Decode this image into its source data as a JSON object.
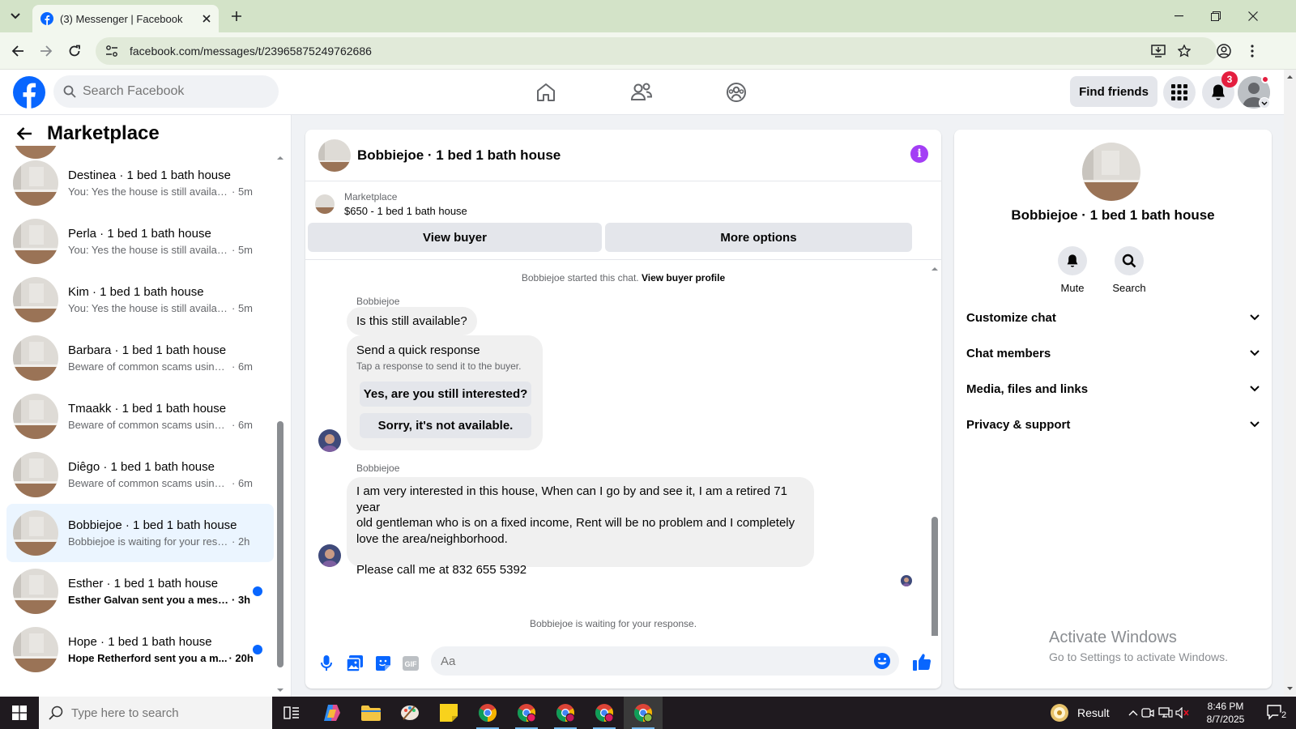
{
  "browser": {
    "tab_title": "(3) Messenger | Facebook",
    "url": "facebook.com/messages/t/23965875249762686"
  },
  "fb": {
    "search_placeholder": "Search Facebook",
    "find_friends": "Find friends",
    "notification_count": "3"
  },
  "left": {
    "title": "Marketplace",
    "conversations": [
      {
        "name": "Destinea · 1 bed 1 bath house",
        "preview": "You: Yes the house is still available ...",
        "time": "· 5m",
        "unread": false,
        "active": false
      },
      {
        "name": "Perla · 1 bed 1 bath house",
        "preview": "You: Yes the house is still available ...",
        "time": "· 5m",
        "unread": false,
        "active": false
      },
      {
        "name": "Kim · 1 bed 1 bath house",
        "preview": "You: Yes the house is still available ...",
        "time": "· 5m",
        "unread": false,
        "active": false
      },
      {
        "name": "Barbara · 1 bed 1 bath house",
        "preview": "Beware of common scams using p...",
        "time": "· 6m",
        "unread": false,
        "active": false
      },
      {
        "name": "Tmaakk · 1 bed 1 bath house",
        "preview": "Beware of common scams using p...",
        "time": "· 6m",
        "unread": false,
        "active": false
      },
      {
        "name": "Diêgo · 1 bed 1 bath house",
        "preview": "Beware of common scams using p...",
        "time": "· 6m",
        "unread": false,
        "active": false
      },
      {
        "name": "Bobbiejoe · 1 bed 1 bath house",
        "preview": "Bobbiejoe is waiting for your respo...",
        "time": "· 2h",
        "unread": false,
        "active": true
      },
      {
        "name": "Esther · 1 bed 1 bath house",
        "preview": "Esther Galvan sent you a messa...",
        "time": "· 3h",
        "unread": true,
        "active": false
      },
      {
        "name": "Hope · 1 bed 1 bath house",
        "preview": "Hope Retherford sent you a m...",
        "time": "· 20h",
        "unread": true,
        "active": false
      }
    ]
  },
  "chat": {
    "title": "Bobbiejoe · 1 bed 1 bath house",
    "listing_category": "Marketplace",
    "listing_price": "$650 - 1 bed 1 bath house",
    "view_buyer": "View buyer",
    "more_options": "More options",
    "started_text": "Bobbiejoe started this chat.",
    "view_buyer_profile": "View buyer profile",
    "sender": "Bobbiejoe",
    "msg1": "Is this still available?",
    "quick_title": "Send a quick response",
    "quick_sub": "Tap a response to send it to the buyer.",
    "quick_1": "Yes, are you still interested?",
    "quick_2": "Sorry, it's not available.",
    "msg2_line1": "I am very interested in this house, When can I go by and see it, I am a retired 71 year",
    "msg2_line2": "old gentleman who  is on a fixed income, Rent will be no problem and I completely",
    "msg2_line3": "love the area/neighborhood.",
    "msg2_line4": "Please call me at 832 655 5392",
    "waiting_text": "Bobbiejoe is waiting for your response.",
    "input_placeholder": "Aa"
  },
  "right": {
    "name": "Bobbiejoe · 1 bed 1 bath house",
    "mute": "Mute",
    "search": "Search",
    "sections": [
      "Customize chat",
      "Chat members",
      "Media, files and links",
      "Privacy & support"
    ]
  },
  "watermark": {
    "line1": "Activate Windows",
    "line2": "Go to Settings to activate Windows."
  },
  "taskbar": {
    "search_placeholder": "Type here to search",
    "result_label": "Result",
    "time": "8:46 PM",
    "date": "8/7/2025",
    "notification_count": "2"
  },
  "colors": {
    "fb_blue": "#0866ff",
    "info_purple": "#a33ef5",
    "badge_red": "#e41e3f"
  }
}
